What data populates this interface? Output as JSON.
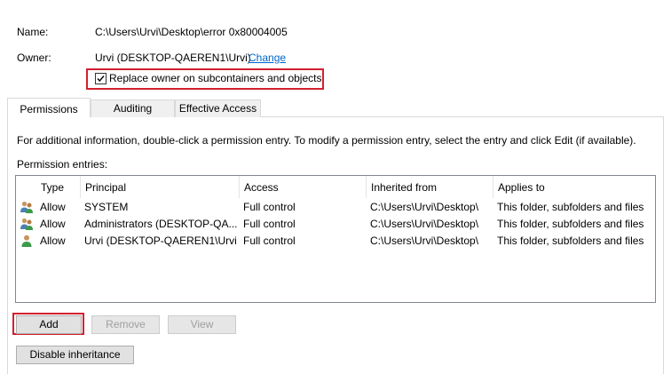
{
  "object": {
    "name_label": "Name:",
    "name_value": "C:\\Users\\Urvi\\Desktop\\error 0x80004005",
    "owner_label": "Owner:",
    "owner_value": "Urvi (DESKTOP-QAEREN1\\Urvi)",
    "change_link": "Change",
    "replace_owner_label": "Replace owner on subcontainers and objects",
    "replace_owner_checked": true
  },
  "tabs": [
    {
      "label": "Permissions",
      "active": true
    },
    {
      "label": "Auditing",
      "active": false
    },
    {
      "label": "Effective Access",
      "active": false
    }
  ],
  "permissions": {
    "info_text": "For additional information, double-click a permission entry. To modify a permission entry, select the entry and click Edit (if available).",
    "entries_label": "Permission entries:",
    "columns": [
      "Type",
      "Principal",
      "Access",
      "Inherited from",
      "Applies to"
    ],
    "rows": [
      {
        "icon": "users-group-icon",
        "type": "Allow",
        "principal": "SYSTEM",
        "access": "Full control",
        "inherited": "C:\\Users\\Urvi\\Desktop\\",
        "applies": "This folder, subfolders and files"
      },
      {
        "icon": "users-group-icon",
        "type": "Allow",
        "principal": "Administrators (DESKTOP-QA...",
        "access": "Full control",
        "inherited": "C:\\Users\\Urvi\\Desktop\\",
        "applies": "This folder, subfolders and files"
      },
      {
        "icon": "user-icon",
        "type": "Allow",
        "principal": "Urvi (DESKTOP-QAEREN1\\Urvi)",
        "access": "Full control",
        "inherited": "C:\\Users\\Urvi\\Desktop\\",
        "applies": "This folder, subfolders and files"
      }
    ]
  },
  "buttons": {
    "add": "Add",
    "remove": "Remove",
    "view": "View",
    "disable_inheritance": "Disable inheritance"
  },
  "colors": {
    "highlight": "#d2202f",
    "link": "#0066cc"
  }
}
